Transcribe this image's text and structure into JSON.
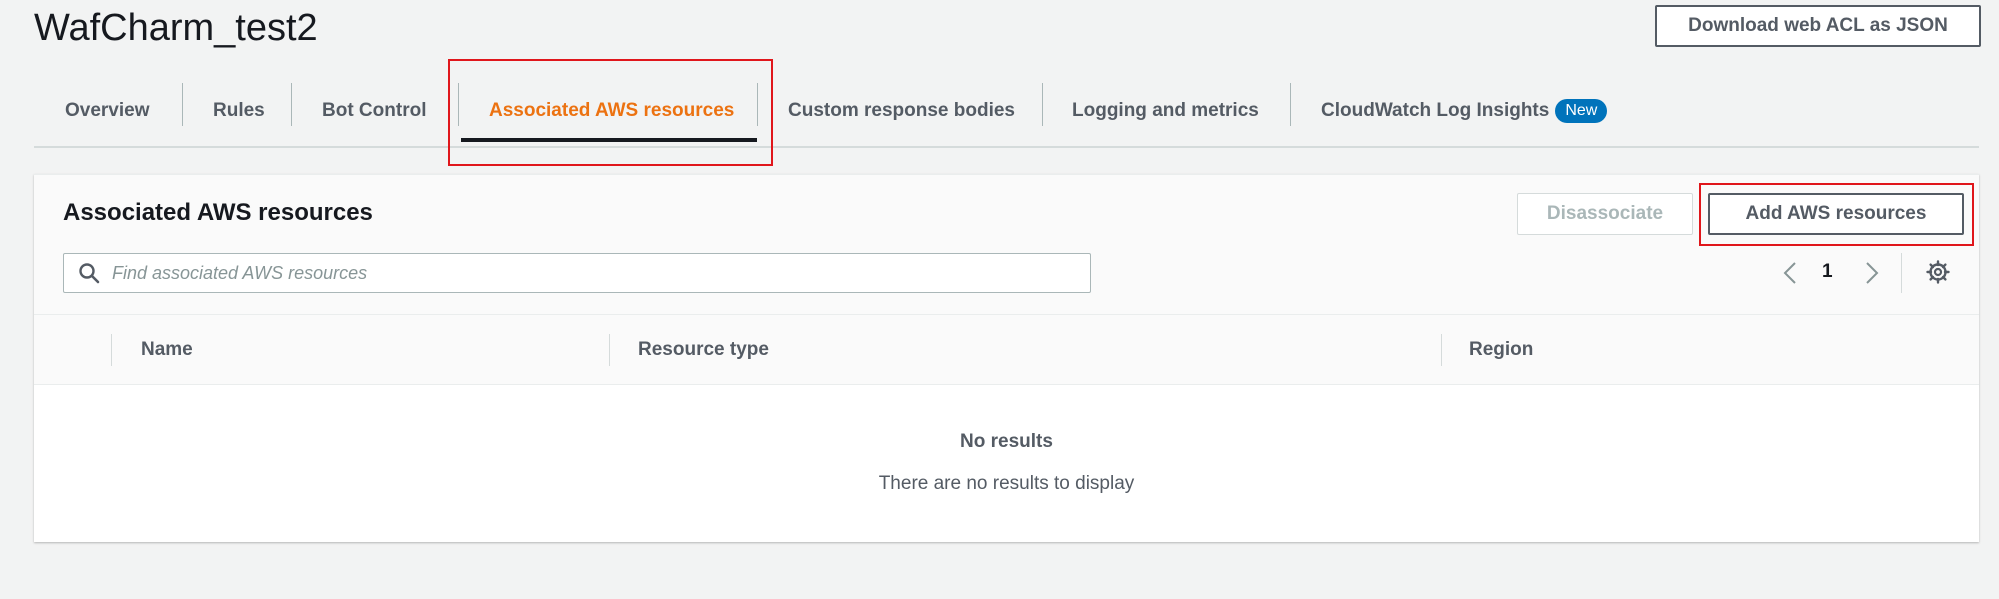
{
  "page": {
    "title": "WafCharm_test2",
    "download_label": "Download web ACL as JSON"
  },
  "tabs": [
    {
      "label": "Overview",
      "active": false
    },
    {
      "label": "Rules",
      "active": false
    },
    {
      "label": "Bot Control",
      "active": false
    },
    {
      "label": "Associated AWS resources",
      "active": true
    },
    {
      "label": "Custom response bodies",
      "active": false
    },
    {
      "label": "Logging and metrics",
      "active": false
    },
    {
      "label": "CloudWatch Log Insights",
      "badge": "New",
      "active": false
    }
  ],
  "panel": {
    "title": "Associated AWS resources",
    "disassociate_label": "Disassociate",
    "add_label": "Add AWS resources",
    "search_placeholder": "Find associated AWS resources",
    "search_value": "",
    "current_page": "1"
  },
  "table": {
    "columns": [
      "Name",
      "Resource type",
      "Region"
    ],
    "rows": [],
    "empty_title": "No results",
    "empty_message": "There are no results to display"
  },
  "colors": {
    "active_tab": "#ec7211",
    "highlight": "#e0161b",
    "badge": "#0073bb"
  },
  "icons": {
    "search": "search-icon",
    "prev": "chevron-left-icon",
    "next": "chevron-right-icon",
    "settings": "gear-icon"
  }
}
